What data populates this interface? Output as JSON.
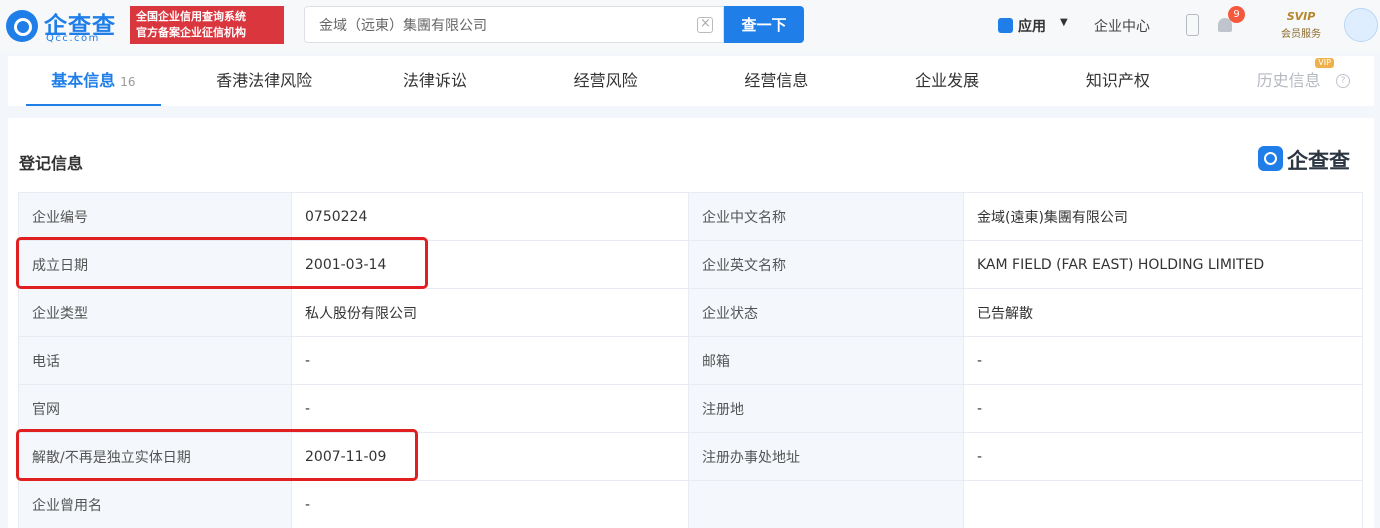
{
  "brand": {
    "name": "企查查",
    "domain": "Qcc.com",
    "badge_line1": "全国企业信用查询系统",
    "badge_line2": "官方备案企业征信机构"
  },
  "search": {
    "value": "金域（远東）集團有限公司",
    "button_label": "查一下"
  },
  "nav": {
    "apps_label": "应用",
    "enterprise_center": "企业中心",
    "notification_count": "9",
    "svip_title": "SVIP",
    "svip_sub": "会员服务"
  },
  "tabs": [
    {
      "label": "基本信息",
      "count": "16"
    },
    {
      "label": "香港法律风险"
    },
    {
      "label": "法律诉讼"
    },
    {
      "label": "经营风险"
    },
    {
      "label": "经营信息"
    },
    {
      "label": "企业发展"
    },
    {
      "label": "知识产权"
    },
    {
      "label": "历史信息",
      "tag": "VIP"
    }
  ],
  "section": {
    "title": "登记信息",
    "watermark": "企查查"
  },
  "rows": [
    {
      "k1": "企业编号",
      "v1": "0750224",
      "k2": "企业中文名称",
      "v2": "金域(遠東)集團有限公司"
    },
    {
      "k1": "成立日期",
      "v1": "2001-03-14",
      "k2": "企业英文名称",
      "v2": "KAM FIELD (FAR EAST) HOLDING LIMITED"
    },
    {
      "k1": "企业类型",
      "v1": "私人股份有限公司",
      "k2": "企业状态",
      "v2": "已告解散"
    },
    {
      "k1": "电话",
      "v1": "-",
      "k2": "邮箱",
      "v2": "-"
    },
    {
      "k1": "官网",
      "v1": "-",
      "k2": "注册地",
      "v2": "-"
    },
    {
      "k1": "解散/不再是独立实体日期",
      "v1": "2007-11-09",
      "k2": "注册办事处地址",
      "v2": "-"
    },
    {
      "k1": "企业曾用名",
      "v1": "-",
      "k2": "",
      "v2": ""
    }
  ],
  "colors": {
    "accent": "#1f7ee8",
    "highlight": "#e02020",
    "badge": "#d9363e"
  }
}
